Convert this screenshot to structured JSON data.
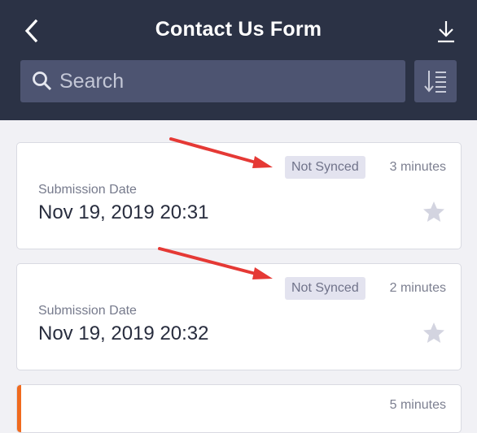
{
  "header": {
    "title": "Contact Us Form",
    "back_icon": "chevron-left-icon",
    "download_icon": "download-icon"
  },
  "search": {
    "placeholder": "Search",
    "icon": "search-icon",
    "sort_icon": "sort-list-icon"
  },
  "submissions": [
    {
      "status": "Not Synced",
      "time": "3 minutes",
      "label": "Submission Date",
      "date": "Nov 19, 2019 20:31",
      "starred": false
    },
    {
      "status": "Not Synced",
      "time": "2 minutes",
      "label": "Submission Date",
      "date": "Nov 19, 2019 20:32",
      "starred": false
    },
    {
      "status": "",
      "time": "5 minutes",
      "label": "",
      "date": "",
      "starred": false
    }
  ],
  "colors": {
    "header_bg": "#2b3245",
    "search_bg": "#4d5471",
    "badge_bg": "#e3e3ef",
    "accent": "#f06a1e",
    "annotation_arrow": "#e53935"
  }
}
